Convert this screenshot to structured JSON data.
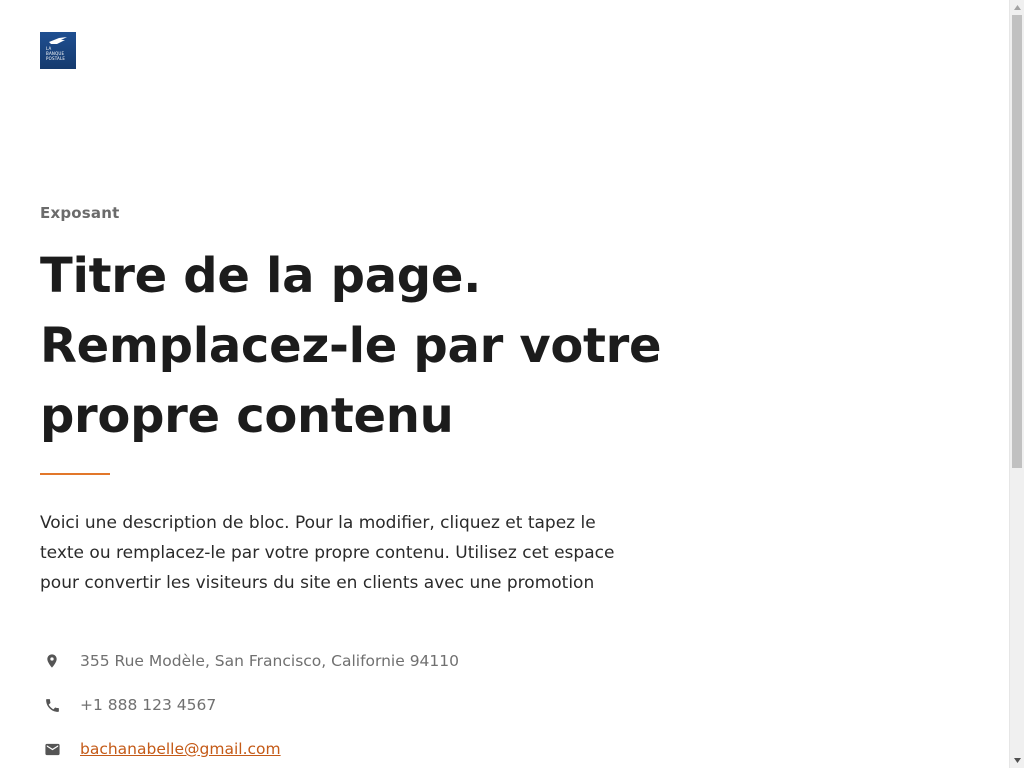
{
  "brand": {
    "logo_lines": "LA\nBANQUE\nPOSTALE",
    "logo_color": "#1f4f91"
  },
  "hero": {
    "eyebrow": "Exposant",
    "title_lines": [
      "Titre de la page.",
      "Remplacez-le par votre",
      "propre contenu"
    ],
    "accent_color": "#e2772a",
    "description_lines": [
      "Voici une description de bloc. Pour la modifier, cliquez et tapez le",
      "texte ou remplacez-le par votre propre contenu. Utilisez cet espace",
      "pour convertir les visiteurs du site en clients avec une promotion"
    ]
  },
  "contacts": [
    {
      "icon": "location-pin-icon",
      "text": "355 Rue Modèle, San Francisco, Californie 94110"
    },
    {
      "icon": "phone-icon",
      "text": "+1 888 123 4567"
    },
    {
      "icon": "mail-icon",
      "text": "bachanabelle@gmail.com",
      "link_color": "#c45a17"
    }
  ],
  "scrollbar": {
    "position_fraction": 0.0,
    "visible_fraction": 0.6
  }
}
